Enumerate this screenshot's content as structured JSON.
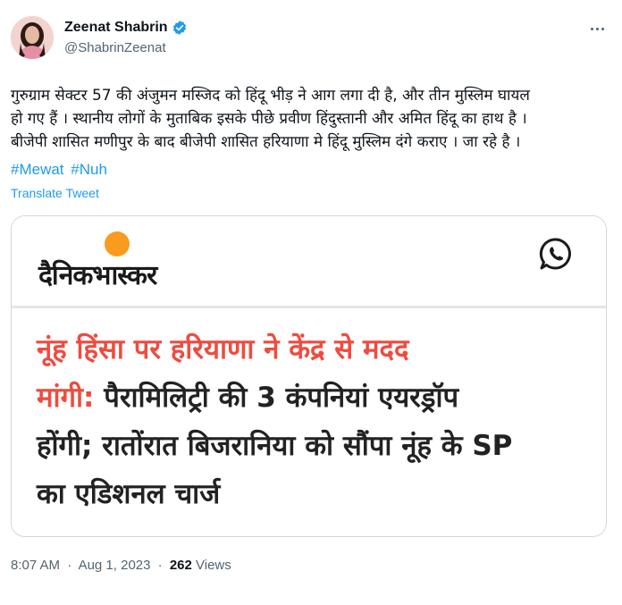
{
  "user": {
    "display_name": "Zeenat Shabrin",
    "handle": "@ShabrinZeenat",
    "verified": true
  },
  "tweet": {
    "lines": [
      "गुरुग्राम सेक्टर 57 की अंजुमन मस्जिद को हिंदू भीड़ ने आग लगा दी है, और तीन मुस्लिम घायल",
      "हो गए हैं । स्थानीय लोगों के मुताबिक इसके पीछे प्रवीण हिंदुस्तानी और अमित हिंदू का हाथ है ।",
      "बीजेपी शासित मणीपुर के बाद बीजेपी शासित हरियाणा मे हिंदू मुस्लिम दंगे कराए । जा रहे है ।"
    ],
    "hashtags": [
      "#Mewat",
      "#Nuh"
    ],
    "translate_label": "Translate Tweet"
  },
  "card": {
    "logo_text": "दैनिकभास्कर",
    "headline_red_1": "नूंह हिंसा पर हरियाणा ने केंद्र से मदद",
    "headline_red_2": "मांगी:",
    "headline_black_2": " पैरामिलिट्री की 3 कंपनियां एयरड्रॉप",
    "headline_black_3": "होंगी; रातोंरात बिजरानिया को सौंपा नूंह के SP",
    "headline_black_4": "का एडिशनल चार्ज"
  },
  "meta": {
    "time": "8:07 AM",
    "separator": "·",
    "date": "Aug 1, 2023",
    "views_count": "262",
    "views_label": "Views"
  },
  "colors": {
    "link": "#1d9bf0",
    "secondary_text": "#536471",
    "headline_red": "#ef4b3f",
    "bhaskar_orange": "#f99b1c",
    "whatsapp": "#1a1a1a"
  },
  "icons": {
    "verified": "verified-badge-icon",
    "more": "more-dots-icon",
    "whatsapp": "whatsapp-icon"
  }
}
